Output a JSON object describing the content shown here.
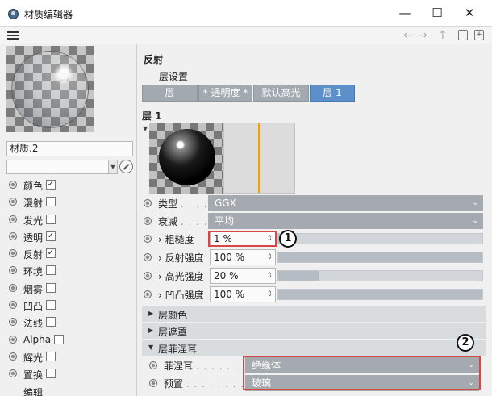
{
  "window": {
    "title": "材质编辑器",
    "minimize": "—",
    "maximize": "☐",
    "close": "✕"
  },
  "toolbar": {
    "back_icon": "←",
    "forward_icon": "→",
    "up_icon": "↑",
    "lock_icon": "🔒",
    "new_icon": "+"
  },
  "material": {
    "name": "材质.2",
    "dropdown_value": ""
  },
  "channels": [
    {
      "label": "颜色",
      "checked": true
    },
    {
      "label": "漫射",
      "checked": false
    },
    {
      "label": "发光",
      "checked": false
    },
    {
      "label": "透明",
      "checked": true
    },
    {
      "label": "反射",
      "checked": true
    },
    {
      "label": "环境",
      "checked": false
    },
    {
      "label": "烟雾",
      "checked": false
    },
    {
      "label": "凹凸",
      "checked": false
    },
    {
      "label": "法线",
      "checked": false
    },
    {
      "label": "Alpha",
      "checked": false
    },
    {
      "label": "辉光",
      "checked": false
    },
    {
      "label": "置换",
      "checked": false
    },
    {
      "label": "编辑",
      "checked": null
    }
  ],
  "panel": {
    "section_title": "反射",
    "layer_settings": "层设置",
    "tabs": [
      {
        "label": "层",
        "active": false
      },
      {
        "label": "* 透明度 *",
        "active": false
      },
      {
        "label": "默认高光",
        "active": false
      },
      {
        "label": "层 1",
        "active": true
      }
    ],
    "layer_label": "层 1",
    "type": {
      "label": "类型",
      "value": "GGX"
    },
    "attenuation": {
      "label": "衰减",
      "value": "平均"
    },
    "roughness": {
      "label": "› 粗糙度",
      "value": "1 %",
      "level": 0.01
    },
    "reflection_strength": {
      "label": "› 反射强度",
      "value": "100 %",
      "level": 1.0
    },
    "specular_strength": {
      "label": "› 高光强度",
      "value": "20 %",
      "level": 0.2
    },
    "bump_strength": {
      "label": "› 凹凸强度",
      "value": "100 %",
      "level": 1.0
    },
    "collapsibles": {
      "layer_color": "层颜色",
      "layer_mask": "层遮罩",
      "layer_fresnel": "层菲涅耳"
    },
    "fresnel": {
      "label": "菲涅耳",
      "value": "绝缘体"
    },
    "preset": {
      "label": "预置",
      "value": "玻璃"
    }
  },
  "annotations": {
    "badge1": "1",
    "badge2": "2"
  },
  "colors": {
    "active_tab": "#5d8fca",
    "callout": "#d94545",
    "curve_marker": "#f0a000"
  }
}
